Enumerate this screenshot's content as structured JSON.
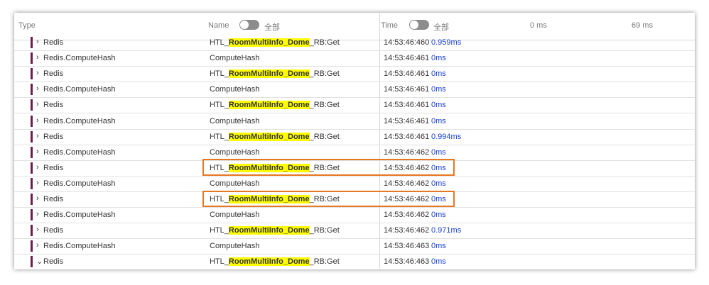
{
  "header": {
    "type_label": "Type",
    "name_label": "Name",
    "name_toggle_label": "全部",
    "time_label": "Time",
    "time_toggle_label": "全部",
    "scale_start": "0 ms",
    "scale_end": "69 ms"
  },
  "rows": [
    {
      "type": "Redis",
      "name_prefix": "HTL_",
      "name_highlight": "RoomMultiInfo_Dome",
      "name_suffix": "_RB:Get",
      "time": "14:53:46:460",
      "duration": "0.959ms",
      "expanded": false
    },
    {
      "type": "Redis.ComputeHash",
      "name": "ComputeHash",
      "time": "14:53:46:461",
      "duration": "0ms",
      "expanded": false
    },
    {
      "type": "Redis",
      "name_prefix": "HTL_",
      "name_highlight": "RoomMultiInfo_Dome",
      "name_suffix": "_RB:Get",
      "time": "14:53:46:461",
      "duration": "0ms",
      "expanded": false
    },
    {
      "type": "Redis.ComputeHash",
      "name": "ComputeHash",
      "time": "14:53:46:461",
      "duration": "0ms",
      "expanded": false
    },
    {
      "type": "Redis",
      "name_prefix": "HTL_",
      "name_highlight": "RoomMultiInfo_Dome",
      "name_suffix": "_RB:Get",
      "time": "14:53:46:461",
      "duration": "0ms",
      "expanded": false
    },
    {
      "type": "Redis.ComputeHash",
      "name": "ComputeHash",
      "time": "14:53:46:461",
      "duration": "0ms",
      "expanded": false
    },
    {
      "type": "Redis",
      "name_prefix": "HTL_",
      "name_highlight": "RoomMultiInfo_Dome",
      "name_suffix": "_RB:Get",
      "time": "14:53:46:461",
      "duration": "0.994ms",
      "expanded": false
    },
    {
      "type": "Redis.ComputeHash",
      "name": "ComputeHash",
      "time": "14:53:46:462",
      "duration": "0ms",
      "expanded": false
    },
    {
      "type": "Redis",
      "name_prefix": "HTL_",
      "name_highlight": "RoomMultiInfo_Dome",
      "name_suffix": "_RB:Get",
      "time": "14:53:46:462",
      "duration": "0ms",
      "expanded": false
    },
    {
      "type": "Redis.ComputeHash",
      "name": "ComputeHash",
      "time": "14:53:46:462",
      "duration": "0ms",
      "expanded": false
    },
    {
      "type": "Redis",
      "name_prefix": "HTL_",
      "name_highlight": "RoomMultiInfo_Dome",
      "name_suffix": "_RB:Get",
      "time": "14:53:46:462",
      "duration": "0ms",
      "expanded": false
    },
    {
      "type": "Redis.ComputeHash",
      "name": "ComputeHash",
      "time": "14:53:46:462",
      "duration": "0ms",
      "expanded": false
    },
    {
      "type": "Redis",
      "name_prefix": "HTL_",
      "name_highlight": "RoomMultiInfo_Dome",
      "name_suffix": "_RB:Get",
      "time": "14:53:46:462",
      "duration": "0.971ms",
      "expanded": false
    },
    {
      "type": "Redis.ComputeHash",
      "name": "ComputeHash",
      "time": "14:53:46:463",
      "duration": "0ms",
      "expanded": false
    },
    {
      "type": "Redis",
      "name_prefix": "HTL_",
      "name_highlight": "RoomMultiInfo_Dome",
      "name_suffix": "_RB:Get",
      "time": "14:53:46:463",
      "duration": "0ms",
      "expanded": true
    }
  ],
  "colors": {
    "type_bar": "#6b1f47",
    "highlight": "#ffff00",
    "duration_text": "#1a3fcc",
    "annotation_box": "#e87722"
  }
}
